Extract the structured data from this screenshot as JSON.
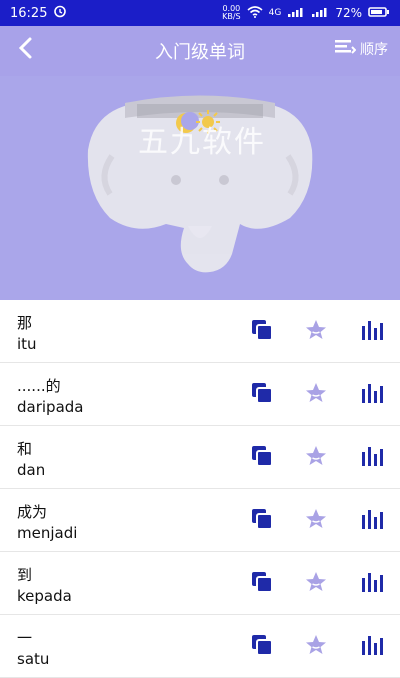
{
  "status": {
    "time": "16:25",
    "speed_value": "0.00",
    "speed_unit": "KB/S",
    "network": "4G",
    "battery": "72%"
  },
  "header": {
    "title": "入门级单词",
    "order_label": "顺序"
  },
  "banner": {
    "watermark_text": "五九软件"
  },
  "words": [
    {
      "zh": "那",
      "ms": "itu"
    },
    {
      "zh": "......的",
      "ms": "daripada"
    },
    {
      "zh": "和",
      "ms": "dan"
    },
    {
      "zh": "成为",
      "ms": "menjadi"
    },
    {
      "zh": "到",
      "ms": "kepada"
    },
    {
      "zh": "一",
      "ms": "satu"
    }
  ],
  "colors": {
    "status_bar": "#1b1ec8",
    "header": "#a8a2e9",
    "banner": "#aaa6ea",
    "icon_blue": "#1f2aa8",
    "star_lavender": "#a9a2e5"
  }
}
